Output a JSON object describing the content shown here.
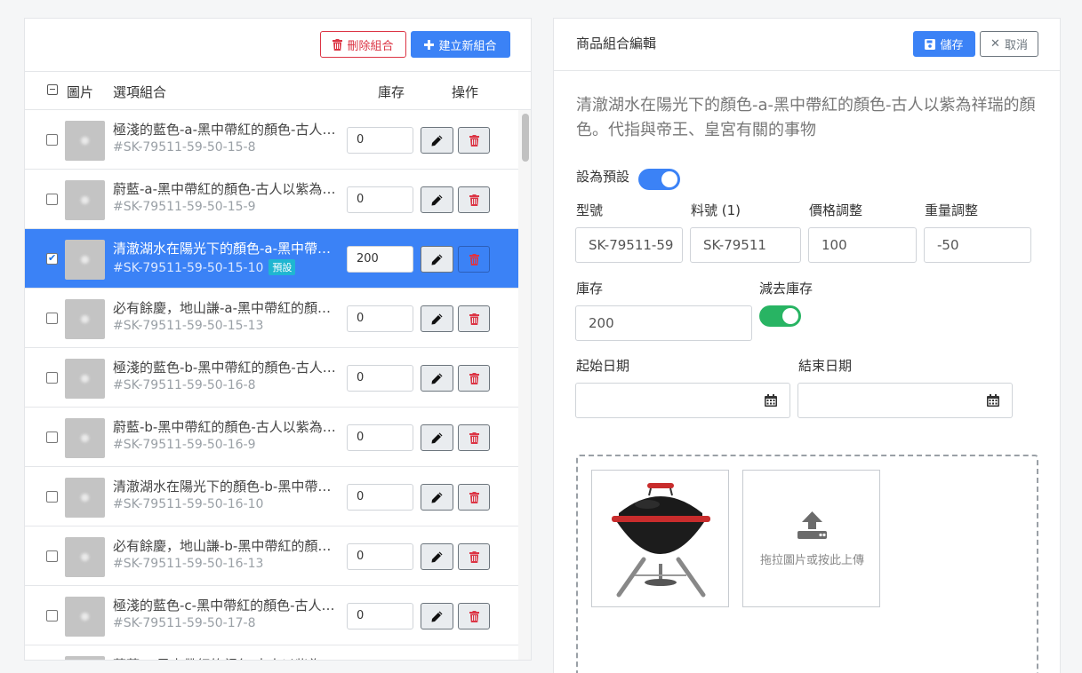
{
  "left_panel": {
    "delete_combo_label": "刪除組合",
    "create_combo_label": "建立新組合",
    "headers": {
      "image": "圖片",
      "option": "選項組合",
      "stock": "庫存",
      "actions": "操作"
    },
    "rows": [
      {
        "name": "極淺的藍色-a-黑中帶紅的顏色-古人以紫為祥瑞的顏色",
        "sku": "#SK-79511-59-50-15-8",
        "qty": "0",
        "selected": false,
        "badge": ""
      },
      {
        "name": "蔚藍-a-黑中帶紅的顏色-古人以紫為祥瑞的顏色",
        "sku": "#SK-79511-59-50-15-9",
        "qty": "0",
        "selected": false,
        "badge": ""
      },
      {
        "name": "清澈湖水在陽光下的顏色-a-黑中帶紅的顏色",
        "sku": "#SK-79511-59-50-15-10",
        "qty": "200",
        "selected": true,
        "badge": "預設"
      },
      {
        "name": "必有餘慶，地山謙-a-黑中帶紅的顏色-古人以紫",
        "sku": "#SK-79511-59-50-15-13",
        "qty": "0",
        "selected": false,
        "badge": ""
      },
      {
        "name": "極淺的藍色-b-黑中帶紅的顏色-古人以紫為祥瑞的顏色",
        "sku": "#SK-79511-59-50-16-8",
        "qty": "0",
        "selected": false,
        "badge": ""
      },
      {
        "name": "蔚藍-b-黑中帶紅的顏色-古人以紫為祥瑞的顏色",
        "sku": "#SK-79511-59-50-16-9",
        "qty": "0",
        "selected": false,
        "badge": ""
      },
      {
        "name": "清澈湖水在陽光下的顏色-b-黑中帶紅的顏色",
        "sku": "#SK-79511-59-50-16-10",
        "qty": "0",
        "selected": false,
        "badge": ""
      },
      {
        "name": "必有餘慶，地山謙-b-黑中帶紅的顏色-古人以紫",
        "sku": "#SK-79511-59-50-16-13",
        "qty": "0",
        "selected": false,
        "badge": ""
      },
      {
        "name": "極淺的藍色-c-黑中帶紅的顏色-古人以紫為祥瑞的顏色",
        "sku": "#SK-79511-59-50-17-8",
        "qty": "0",
        "selected": false,
        "badge": ""
      },
      {
        "name": "蔚藍-c-黑中帶紅的顏色-古人以紫為祥瑞的顏色",
        "sku": "",
        "qty": "0",
        "selected": false,
        "badge": ""
      }
    ]
  },
  "right_panel": {
    "title": "商品組合編輯",
    "save_label": "儲存",
    "cancel_label": "取消",
    "description": "清澈湖水在陽光下的顏色-a-黑中帶紅的顏色-古人以紫為祥瑞的顏色。代指與帝王、皇宮有關的事物",
    "default_label": "設為預設",
    "default_on": true,
    "model_label": "型號",
    "model_value": "SK-79511-59",
    "part_label": "料號 (1)",
    "part_value": "SK-79511",
    "price_label": "價格調整",
    "price_value": "100",
    "weight_label": "重量調整",
    "weight_value": "-50",
    "stock_label": "庫存",
    "stock_value": "200",
    "deduct_label": "減去庫存",
    "deduct_on": true,
    "start_date_label": "起始日期",
    "start_date_value": "",
    "end_date_label": "結束日期",
    "end_date_value": "",
    "upload_hint": "拖拉圖片或按此上傳"
  },
  "colors": {
    "primary": "#3b82f6",
    "danger": "#dc3545",
    "success": "#28b463",
    "badge": "#1fb6d1"
  },
  "icons": [
    "trash-icon",
    "plus-icon",
    "save-icon",
    "close-icon",
    "pencil-icon",
    "calendar-icon",
    "upload-icon"
  ]
}
